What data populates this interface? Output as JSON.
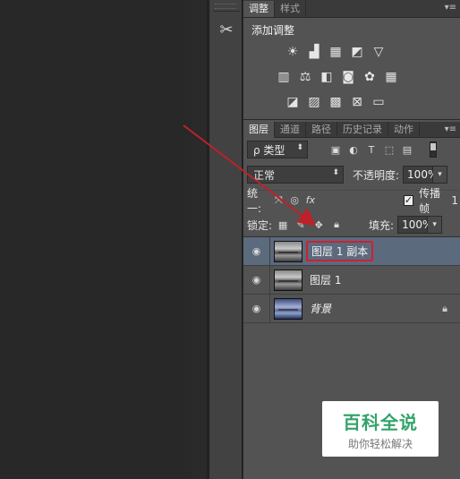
{
  "adjustments": {
    "tabs": [
      "调整",
      "样式"
    ],
    "title": "添加调整"
  },
  "layers_panel": {
    "tabs": [
      "图层",
      "通道",
      "路径",
      "历史记录",
      "动作"
    ],
    "filter": {
      "kind_label": "ρ 类型"
    },
    "blend_mode": "正常",
    "opacity_label": "不透明度:",
    "opacity_value": "100%",
    "unify_label": "统一:",
    "propagate_label": "传播帧",
    "propagate_value": "1",
    "lock_label": "锁定:",
    "fill_label": "填充:",
    "fill_value": "100%",
    "layers": [
      {
        "name": "图层 1 副本",
        "selected": true,
        "visible": true
      },
      {
        "name": "图层 1",
        "selected": false,
        "visible": true
      },
      {
        "name": "背景",
        "selected": false,
        "visible": true,
        "locked": true
      }
    ]
  },
  "watermark": {
    "main": "百科全说",
    "sub": "助你轻松解决"
  },
  "colors": {
    "selected_row": "#5c6a7d",
    "highlight_box": "#d02030",
    "arrow": "#c0202a",
    "watermark_green": "#33a36a"
  }
}
